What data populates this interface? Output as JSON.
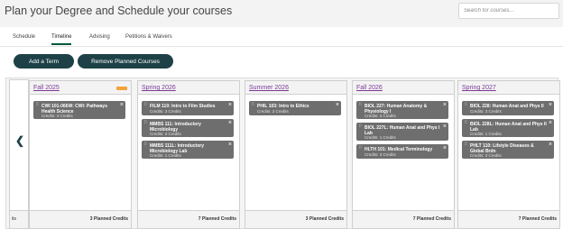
{
  "header": {
    "title": "Plan your Degree and Schedule your courses",
    "search_placeholder": "Search for courses..."
  },
  "tabs": [
    {
      "label": "Schedule"
    },
    {
      "label": "Timeline",
      "active": true
    },
    {
      "label": "Advising"
    },
    {
      "label": "Petitions & Waivers"
    }
  ],
  "actions": {
    "add_term": "Add a Term",
    "remove_planned": "Remove Planned Courses"
  },
  "timeline": {
    "prev_icon": "chevron-left-icon",
    "prev_credits_text": "its",
    "terms": [
      {
        "name": "Fall 2025",
        "has_warning": true,
        "credits_label": "3 Planned Credits",
        "courses": [
          {
            "title": "CWI 101-066W: CWI: Pathways Health Science",
            "credits": "Credits: 3 Credits"
          }
        ]
      },
      {
        "name": "Spring 2026",
        "credits_label": "7 Planned Credits",
        "courses": [
          {
            "title": "FILM 110: Intro to Film Studies",
            "credits": "Credits: 3 Credits"
          },
          {
            "title": "MMBS 111: Introductory Microbiology",
            "credits": "Credits: 3 Credits"
          },
          {
            "title": "MMBS 111L: Introductory Microbiology Lab",
            "credits": "Credits: 1 Credits"
          }
        ]
      },
      {
        "name": "Summer 2026",
        "credits_label": "3 Planned Credits",
        "courses": [
          {
            "title": "PHIL 103: Intro to Ethics",
            "credits": "Credits: 3 Credits"
          }
        ]
      },
      {
        "name": "Fall 2026",
        "credits_label": "7 Planned Credits",
        "courses": [
          {
            "title": "BIOL 227: Human Anatomy & Physiology I",
            "credits": "Credits: 3 Credits"
          },
          {
            "title": "BIOL 227L: Human Anat and Phys I Lab",
            "credits": "Credits: 1 Credits"
          },
          {
            "title": "HLTH 101: Medical Terminology",
            "credits": "Credits: 3 Credits"
          }
        ]
      },
      {
        "name": "Spring 2027",
        "credits_label": "7 Planned Credits",
        "courses": [
          {
            "title": "BIOL 228: Human Anat and Phys II",
            "credits": "Credits: 3 Credits"
          },
          {
            "title": "BIOL 228L: Human Anat and Phys II Lab",
            "credits": "Credits: 1 Credits"
          },
          {
            "title": "PHLT 110: Lifstyle Diseases & Global Brdn",
            "credits": "Credits: 3 Credits"
          }
        ]
      }
    ]
  }
}
